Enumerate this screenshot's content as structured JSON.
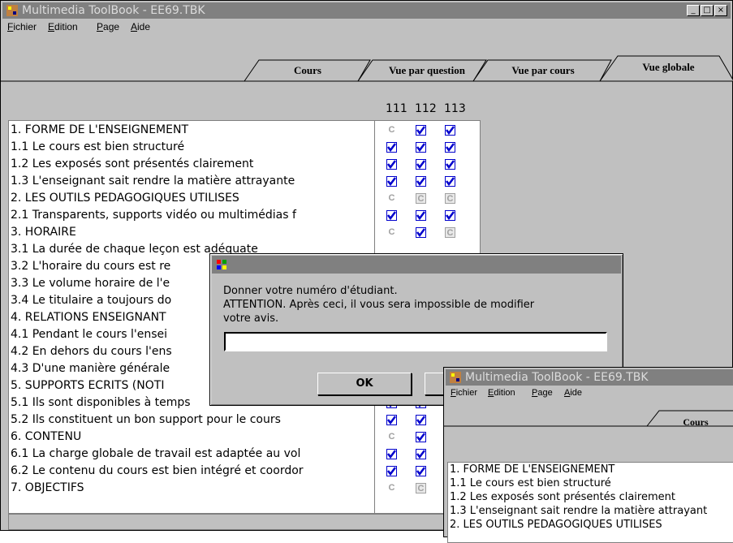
{
  "main_window": {
    "title": "Multimedia ToolBook - EE69.TBK",
    "menus": [
      "Fichier",
      "Edition",
      "Page",
      "Aide"
    ],
    "tabs": [
      "Cours",
      "Vue par question",
      "Vue par cours",
      "Vue globale"
    ],
    "active_tab": "Vue globale",
    "column_headers": [
      "111",
      "112",
      "113"
    ],
    "rows": [
      {
        "label": "1. FORME DE L'ENSEIGNEMENT",
        "cells": [
          "c",
          "check",
          "check"
        ]
      },
      {
        "label": "1.1 Le cours est bien structuré",
        "cells": [
          "check",
          "check",
          "check"
        ]
      },
      {
        "label": "1.2 Les exposés sont présentés clairement",
        "cells": [
          "check",
          "check",
          "check"
        ]
      },
      {
        "label": "1.3 L'enseignant sait rendre la matière attrayante",
        "cells": [
          "check",
          "check",
          "check"
        ]
      },
      {
        "label": "2. LES OUTILS PEDAGOGIQUES UTILISES",
        "cells": [
          "c",
          "cbox",
          "cbox"
        ]
      },
      {
        "label": "2.1 Transparents, supports vidéo ou multimédias f",
        "cells": [
          "check",
          "check",
          "check"
        ]
      },
      {
        "label": "3. HORAIRE",
        "cells": [
          "c",
          "check",
          "cbox"
        ]
      },
      {
        "label": "3.1 La durée de chaque leçon est adéquate",
        "cells": [
          "",
          "",
          ""
        ]
      },
      {
        "label": "3.2 L'horaire du cours est re",
        "cells": [
          "",
          "",
          ""
        ]
      },
      {
        "label": "3.3 Le volume horaire de l'e",
        "cells": [
          "",
          "",
          ""
        ]
      },
      {
        "label": "3.4 Le titulaire a toujours do",
        "cells": [
          "",
          "",
          ""
        ]
      },
      {
        "label": "4. RELATIONS ENSEIGNANT",
        "cells": [
          "",
          "",
          ""
        ]
      },
      {
        "label": "4.1 Pendant le cours l'ensei",
        "cells": [
          "",
          "",
          ""
        ]
      },
      {
        "label": "4.2 En dehors du cours l'ens",
        "cells": [
          "",
          "",
          ""
        ]
      },
      {
        "label": "4.3 D'une manière générale",
        "cells": [
          "",
          "",
          ""
        ]
      },
      {
        "label": "5. SUPPORTS ECRITS (NOTI",
        "cells": [
          "",
          "",
          ""
        ]
      },
      {
        "label": "5.1 Ils sont disponibles à temps",
        "cells": [
          "check",
          "check",
          ""
        ]
      },
      {
        "label": "5.2 Ils constituent un bon support pour le cours",
        "cells": [
          "check",
          "check",
          ""
        ]
      },
      {
        "label": "6. CONTENU",
        "cells": [
          "c",
          "check",
          ""
        ]
      },
      {
        "label": "6.1 La charge globale de travail est adaptée au vol",
        "cells": [
          "check",
          "check",
          ""
        ]
      },
      {
        "label": "6.2 Le contenu du cours est bien intégré et coordor",
        "cells": [
          "check",
          "check",
          ""
        ]
      },
      {
        "label": "7. OBJECTIFS",
        "cells": [
          "c",
          "cbox",
          ""
        ]
      }
    ]
  },
  "dialog": {
    "message_line1": "Donner votre numéro d'étudiant.",
    "message_line2": "ATTENTION. Après ceci, il vous sera impossible de modifier",
    "message_line3": "votre avis.",
    "input_value": "",
    "ok_label": "OK"
  },
  "second_window": {
    "title": "Multimedia ToolBook - EE69.TBK",
    "menus": [
      "Fichier",
      "Edition",
      "Page",
      "Aide"
    ],
    "tab": "Cours",
    "rows": [
      "1. FORME DE L'ENSEIGNEMENT",
      "1.1 Le cours est bien structuré",
      "1.2 Les exposés sont présentés clairement",
      "1.3 L'enseignant sait rendre la matière attrayant",
      "2. LES OUTILS PEDAGOGIQUES UTILISES"
    ]
  },
  "colors": {
    "title_inactive": "#808080",
    "check_blue": "#0000cc",
    "face": "#c0c0c0"
  }
}
